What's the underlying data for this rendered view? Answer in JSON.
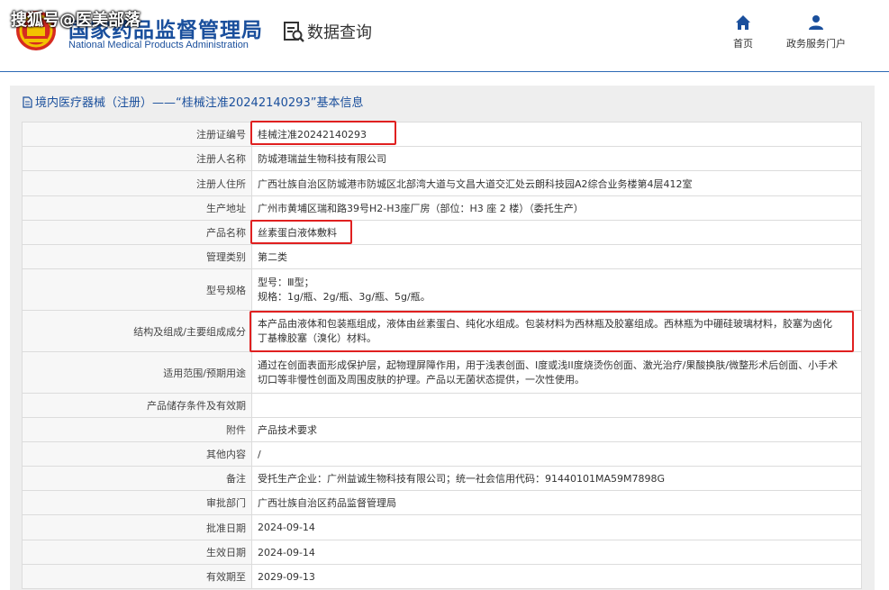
{
  "header": {
    "logo_cn": "国家药品监督管理局",
    "logo_en": "National Medical Products Administration",
    "watermark": "搜狐号@医美部落",
    "query_title": "数据查询",
    "nav": [
      {
        "label": "首页",
        "icon": "home-icon"
      },
      {
        "label": "政务服务门户",
        "icon": "user-icon"
      }
    ],
    "brand_color": "#1a4f9c"
  },
  "panel": {
    "title": "境内医疗器械（注册）——“桂械注准20242140293”基本信息"
  },
  "fields": [
    {
      "label": "注册证编号",
      "value": "桂械注准20242140293"
    },
    {
      "label": "注册人名称",
      "value": "防城港瑞益生物科技有限公司"
    },
    {
      "label": "注册人住所",
      "value": "广西壮族自治区防城港市防城区北部湾大道与文昌大道交汇处云朗科技园A2综合业务楼第4层412室"
    },
    {
      "label": "生产地址",
      "value": "广州市黄埔区瑞和路39号H2-H3座厂房（部位：H3 座 2 楼）（委托生产）"
    },
    {
      "label": "产品名称",
      "value": "丝素蛋白液体敷料"
    },
    {
      "label": "管理类别",
      "value": "第二类"
    },
    {
      "label": "型号规格",
      "value_line1": "型号：Ⅲ型；",
      "value_line2": "规格：1g/瓶、2g/瓶、3g/瓶、5g/瓶。"
    },
    {
      "label": "结构及组成/主要组成成分",
      "value_line1": "本产品由液体和包装瓶组成，液体由丝素蛋白、纯化水组成。包装材料为西林瓶及胶塞组成。西林瓶为中硼硅玻璃材料，胶塞为卤化",
      "value_line2": "丁基橡胶塞（溴化）材料。"
    },
    {
      "label": "适用范围/预期用途",
      "value_line1": "通过在创面表面形成保护层，起物理屏障作用，用于浅表创面、I度或浅II度烧烫伤创面、激光治疗/果酸换肤/微整形术后创面、小手术",
      "value_line2": "切口等非慢性创面及周围皮肤的护理。产品以无菌状态提供，一次性使用。"
    },
    {
      "label": "产品储存条件及有效期",
      "value": ""
    },
    {
      "label": "附件",
      "value": "产品技术要求"
    },
    {
      "label": "其他内容",
      "value": "/"
    },
    {
      "label": "备注",
      "value": "受托生产企业：广州益诚生物科技有限公司；统一社会信用代码：91440101MA59M7898G"
    },
    {
      "label": "审批部门",
      "value": "广西壮族自治区药品监督管理局"
    },
    {
      "label": "批准日期",
      "value": "2024-09-14"
    },
    {
      "label": "生效日期",
      "value": "2024-09-14"
    },
    {
      "label": "有效期至",
      "value": "2029-09-13"
    }
  ]
}
